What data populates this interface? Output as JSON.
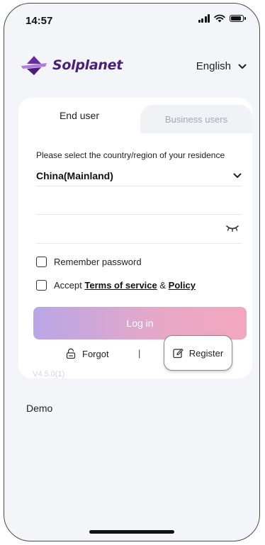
{
  "status_bar": {
    "time": "14:57",
    "icons": [
      "signal-icon",
      "wifi-icon",
      "battery-icon"
    ]
  },
  "header": {
    "brand": "Solplanet",
    "language": "English",
    "brand_colors": [
      "#4a1e7a",
      "#9b5ad1"
    ]
  },
  "tabs": {
    "active": "End user",
    "inactive": "Business users"
  },
  "form": {
    "country_label": "Please select the country/region of your residence",
    "country_value": "China(Mainland)",
    "account_value": "",
    "password_value": "",
    "remember_label": "Remember password",
    "accept_prefix": "Accept",
    "terms_link": "Terms of service",
    "ampersand": "&",
    "policy_link": "Policy",
    "login_label": "Log in",
    "login_gradient": [
      "#b9a6e6",
      "#f3a7be"
    ]
  },
  "links": {
    "forgot": "Forgot",
    "separator": "|",
    "register": "Register"
  },
  "version": "V4.5.0(1)",
  "demo": "Demo"
}
